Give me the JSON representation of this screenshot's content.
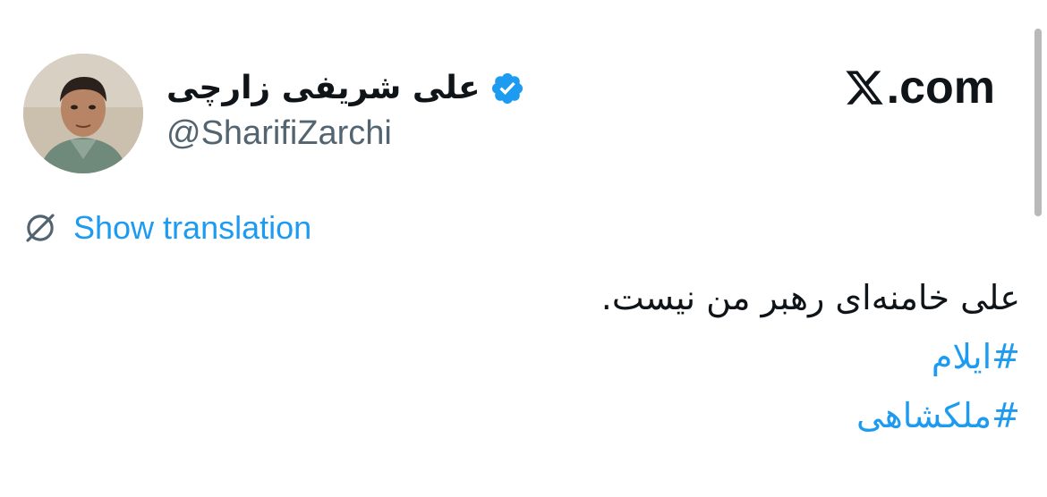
{
  "author": {
    "display_name": "علی شریفی زارچی",
    "handle": "@SharifiZarchi",
    "verified": true
  },
  "brand": {
    "label": ".com"
  },
  "translate": {
    "label": "Show translation"
  },
  "tweet": {
    "text": "علی خامنه‌ای رهبر من نیست.",
    "hashtags": [
      "#ایلام",
      "#ملکشاهی"
    ]
  },
  "colors": {
    "link": "#1d9bf0",
    "handle": "#536471",
    "text": "#0f1419"
  },
  "icons": {
    "verified": "verified-badge-icon",
    "x_logo": "x-logo-icon",
    "translate": "translate-icon"
  }
}
